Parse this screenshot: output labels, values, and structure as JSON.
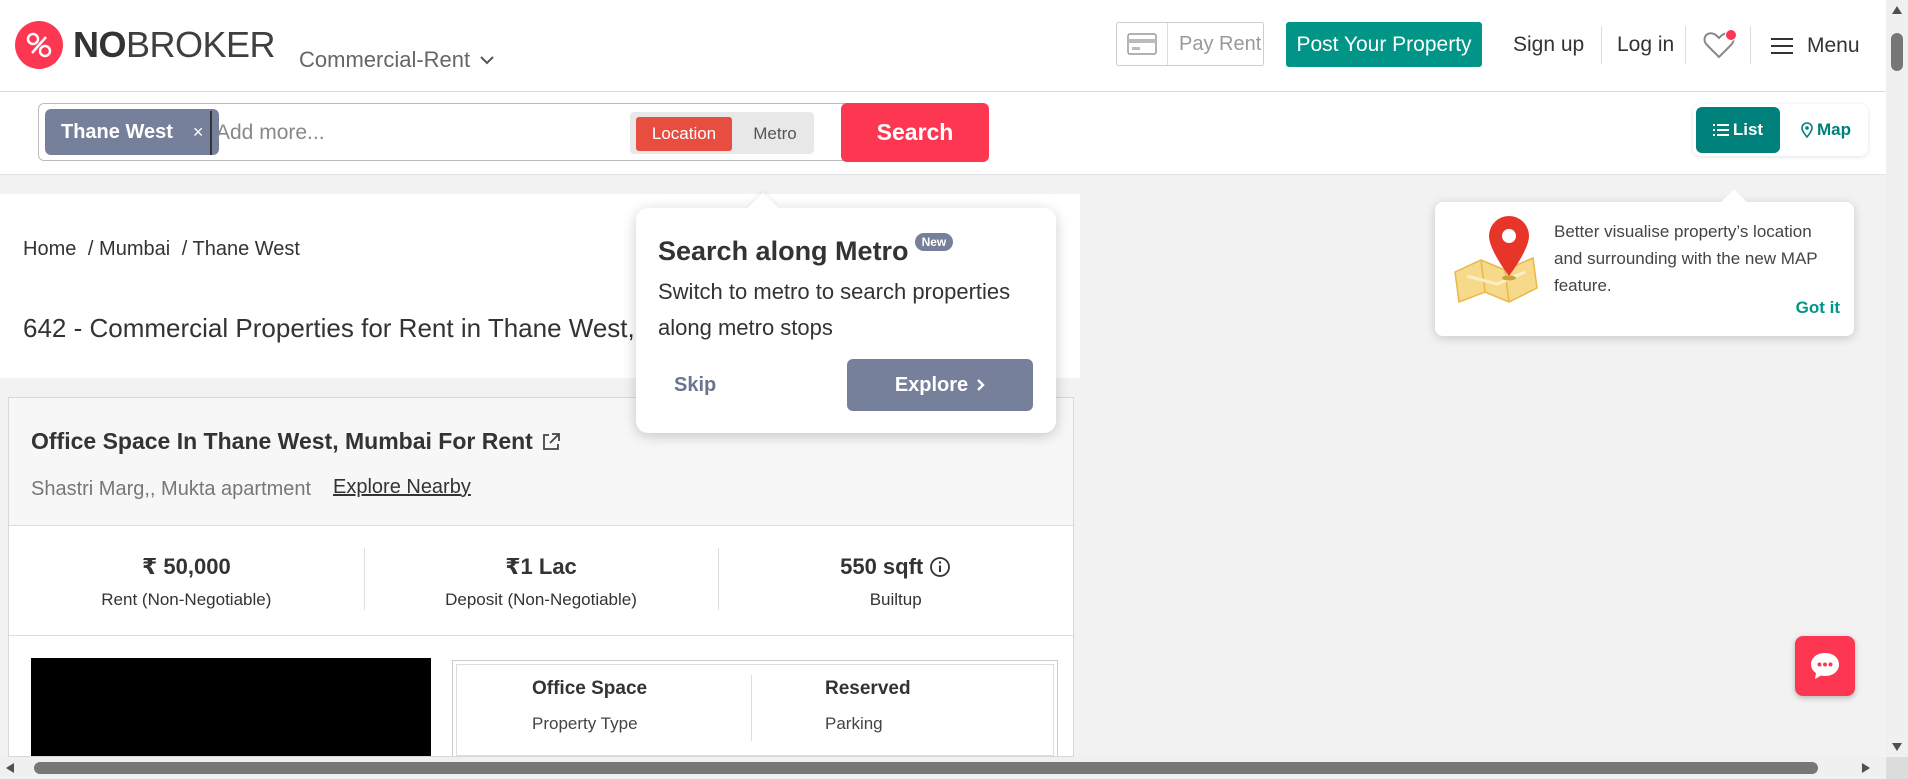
{
  "header": {
    "logo_text_bold": "NO",
    "logo_text_rest": "BROKER",
    "category": "Commercial-Rent",
    "pay_rent": "Pay Rent",
    "post_property": "Post Your Property",
    "sign_up": "Sign up",
    "log_in": "Log in",
    "menu": "Menu",
    "brand_color": "#fd3752",
    "accent_color": "#009587"
  },
  "search": {
    "chip_label": "Thane West",
    "chip_remove": "×",
    "placeholder": "Add more...",
    "mode_location": "Location",
    "mode_metro": "Metro",
    "search_button": "Search",
    "view_list": "List",
    "view_map": "Map"
  },
  "breadcrumb": {
    "home": "Home",
    "city": "/ Mumbai",
    "locality": "/ Thane West"
  },
  "page_title": "642 - Commercial Properties for Rent in Thane West, Mu",
  "listing": {
    "title": "Office Space In Thane West, Mumbai For Rent",
    "address": "Shastri Marg,, Mukta apartment",
    "explore_nearby": "Explore Nearby",
    "rent_value": "₹ 50,000",
    "rent_label": "Rent (Non-Negotiable)",
    "deposit_value": "₹1 Lac",
    "deposit_label": "Deposit (Non-Negotiable)",
    "area_value": "550 sqft",
    "area_label": "Builtup",
    "property_type_value": "Office Space",
    "property_type_label": "Property Type",
    "parking_value": "Reserved",
    "parking_label": "Parking"
  },
  "metro_popup": {
    "title": "Search along Metro",
    "badge": "New",
    "text": "Switch to metro to search properties along metro stops",
    "skip": "Skip",
    "explore": "Explore"
  },
  "map_popup": {
    "text": "Better visualise property’s location and surrounding with the new MAP feature.",
    "got_it": "Got it"
  }
}
